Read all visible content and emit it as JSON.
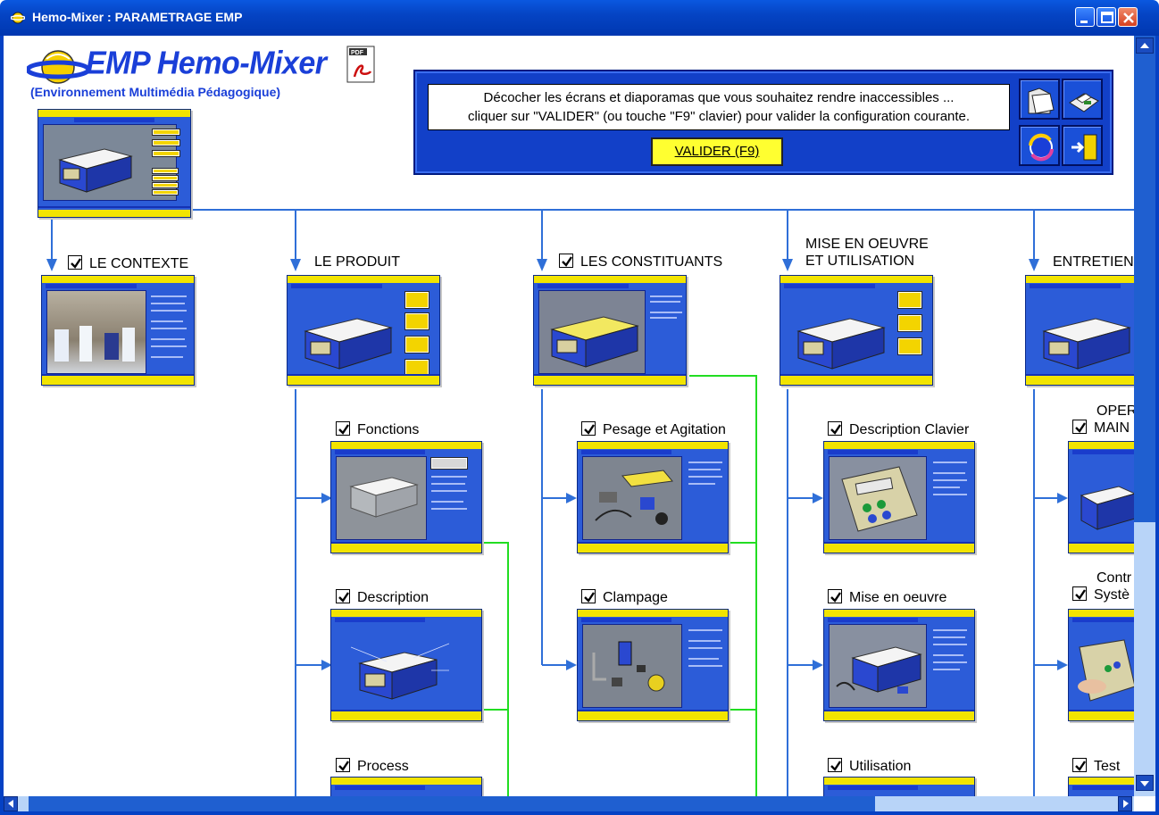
{
  "window": {
    "title": "Hemo-Mixer : PARAMETRAGE EMP"
  },
  "logo": {
    "title": "EMP Hemo-Mixer",
    "subtitle": "(Environnement Multimédia Pédagogique)"
  },
  "panel": {
    "message_line1": "Décocher les écrans et diaporamas que vous souhaitez rendre inaccessibles ...",
    "message_line2": "cliquer sur \"VALIDER\" (ou touche \"F9\" clavier) pour valider la configuration courante.",
    "validate_label": "VALIDER (F9)"
  },
  "sections": [
    {
      "label": "LE CONTEXTE",
      "checked": true
    },
    {
      "label": "LE PRODUIT",
      "checked": false
    },
    {
      "label": "LES CONSTITUANTS",
      "checked": true
    },
    {
      "label_line1": "MISE EN OEUVRE",
      "label_line2": "ET UTILISATION",
      "checked": false
    },
    {
      "label": "ENTRETIEN",
      "checked": false
    }
  ],
  "sub_items": {
    "produit": [
      {
        "label": "Fonctions",
        "checked": true
      },
      {
        "label": "Description",
        "checked": true
      },
      {
        "label": "Process",
        "checked": true
      }
    ],
    "constituants": [
      {
        "label": "Pesage et Agitation",
        "checked": true
      },
      {
        "label": "Clampage",
        "checked": true
      }
    ],
    "mise_en_oeuvre": [
      {
        "label": "Description Clavier",
        "checked": true
      },
      {
        "label": "Mise en oeuvre",
        "checked": true
      },
      {
        "label": "Utilisation",
        "checked": true
      }
    ],
    "entretien": [
      {
        "label_line1": "OPER",
        "label_line2": "MAIN",
        "checked": true
      },
      {
        "label_line1": "Contr",
        "label_line2": "Systè",
        "checked": true
      },
      {
        "label": "Test",
        "checked": true
      }
    ]
  },
  "icons": {
    "app": "hemo-globe-icon",
    "pdf": "pdf-document-icon",
    "open": "folder-open-icon",
    "print": "printer-icon",
    "refresh": "refresh-icon",
    "exit": "exit-door-icon"
  },
  "colors": {
    "accent_blue": "#1240c8",
    "button_yellow": "#ffff30",
    "connector_blue": "#2f6fd8",
    "connector_green": "#22dd22"
  }
}
